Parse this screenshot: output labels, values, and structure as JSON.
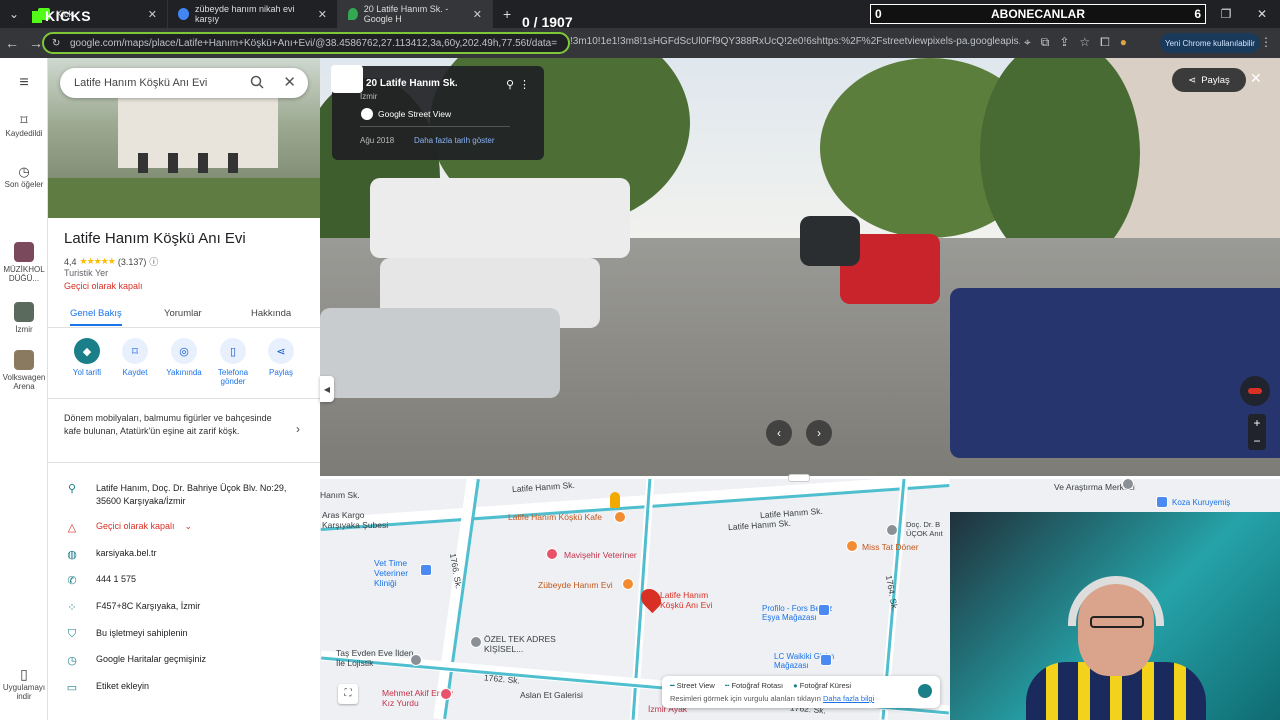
{
  "browser": {
    "tabs": [
      {
        "label": "Kick",
        "active": false
      },
      {
        "label": "zübeyde hanım nikah evi karşıy",
        "active": false
      },
      {
        "label": "20 Latife Hanım Sk. - Google H",
        "active": true
      }
    ],
    "new_tab": "+",
    "url_visible": "google.com/maps/place/Latife+Hanım+Köşkü+Anı+Evi/@38.4586762,27.113412,3a,60y,202.49h,77.56t/data=",
    "url_tail": "!3m10!1e1!3m8!1sHGFdScUl0Ff9QY388RxUcQ!2e0!6shttps:%2F%2Fstreetviewpixels-pa.googleapis.com%2Fv1...",
    "chrome_button": "Yeni Chrome kullanılabilir",
    "accent": "#7ec837"
  },
  "overlay": {
    "kicks": "KICKS",
    "counter": "0 / 1907",
    "subs_left": "0",
    "subs_title": "ABONECANLAR",
    "subs_right": "6"
  },
  "rail": {
    "items": [
      {
        "label": "Kaydedildi"
      },
      {
        "label": "Son öğeler"
      },
      {
        "label": "MÜZİKHOL DÜĞÜ..."
      },
      {
        "label": "İzmir"
      },
      {
        "label": "Volkswagen Arena"
      },
      {
        "label": "Uygulamayı indir"
      }
    ]
  },
  "search": {
    "value": "Latife Hanım Köşkü Anı Evi"
  },
  "place": {
    "title": "Latife Hanım Köşkü Anı Evi",
    "rating": "4,4",
    "stars": "★★★★★",
    "reviews": "(3.137)",
    "type": "Turistik Yer",
    "status": "Geçici olarak kapalı",
    "tabs": [
      "Genel Bakış",
      "Yorumlar",
      "Hakkında"
    ],
    "actions": [
      "Yol tarifi",
      "Kaydet",
      "Yakınında",
      "Telefona gönder",
      "Paylaş"
    ],
    "description": "Dönem mobilyaları, balmumu figürler ve bahçesinde kafe bulunan, Atatürk'ün eşine ait zarif köşk.",
    "address": "Latife Hanım, Doç. Dr. Bahriye Üçok Blv. No:29, 35600 Karşıyaka/İzmir",
    "closed_row": "Geçici olarak kapalı",
    "website": "karsiyaka.bel.tr",
    "phone": "444 1 575",
    "plus_code": "F457+8C Karşıyaka, İzmir",
    "claim": "Bu işletmeyi sahiplenin",
    "history": "Google Haritalar geçmişiniz",
    "label": "Etiket ekleyin"
  },
  "streetview": {
    "street": "20 Latife Hanım Sk.",
    "city": "İzmir",
    "brand": "Google Street View",
    "date": "Ağu 2018",
    "more_dates": "Daha fazla tarih göster",
    "share": "Paylaş"
  },
  "map": {
    "labels": {
      "street1": "Latife Hanım Sk.",
      "street2": "Latife Hanım Sk.",
      "street3": "Latife Hanım Sk.",
      "street4": "1762. Sk.",
      "street5": "1762. Sk.",
      "street6": "1766. Sk.",
      "street7": "1764. Sk.",
      "street8": "1762. Sk.",
      "street9": "Hanım Sk.",
      "aras": "Aras Kargo Karşıyaka Şubesi",
      "vet": "Vet Time Veteriner Kliniği",
      "ozel": "ÖZEL TEK ADRES KİŞİSEL...",
      "tas": "Taş Evden Eve İlden İle Lojistik",
      "mehmet": "Mehmet Akif Ersoy Kız Yurdu",
      "aslan": "Aslan Et Galerisi",
      "kafe": "Latife Hanım Köşkü Kafe",
      "mavisehir": "Mavişehir Veteriner",
      "zubeyde": "Zübeyde Hanım Evi",
      "latife": "Latife Hanım Köşkü Anı Evi",
      "docdr": "Doç. Dr. B ÜÇOK Anıt",
      "miss": "Miss Tat Döner",
      "profilo": "Profilo - Fors Beyaz Eşya Mağazası",
      "lcw": "LC Waikiki Giyim Mağazası",
      "izmir_ayak": "İzmir Ayak",
      "koza": "Koza Kuruyemiş",
      "arastirma": "Ve Araştırma Merkezi"
    },
    "legend_sv": "Street View",
    "legend_route": "Fotoğraf Rotası",
    "legend_sphere": "Fotoğraf Küresi",
    "legend_note": "Resimleri görmek için vurgulu alanları tıklayın",
    "legend_link": "Daha fazla bilgi"
  }
}
